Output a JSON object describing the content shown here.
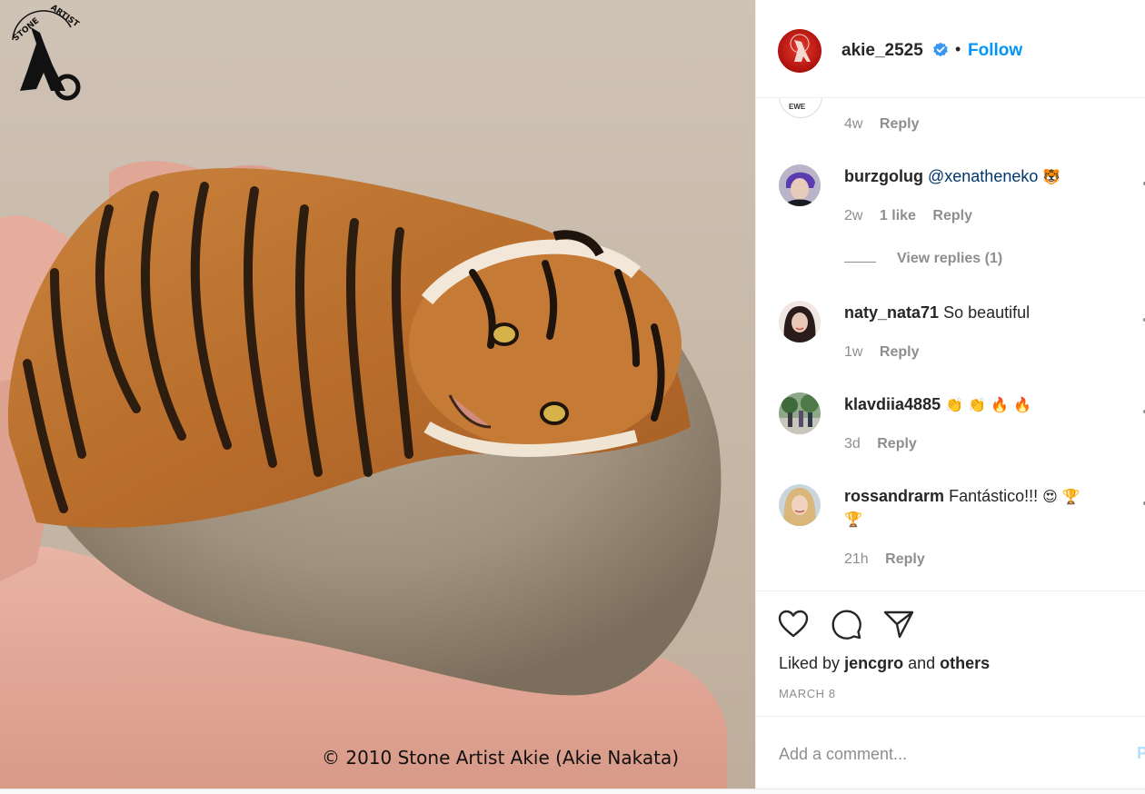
{
  "photo": {
    "credit": "© 2010 Stone Artist Akie (Akie Nakata)",
    "logo_text": "STONE ARTIST"
  },
  "header": {
    "username": "akie_2525",
    "separator": "•",
    "follow_label": "Follow",
    "verified_icon": "verified-badge-icon"
  },
  "comments": {
    "peek": {
      "avatar_text": "EWE",
      "time": "4w",
      "reply_label": "Reply"
    },
    "items": [
      {
        "username": "burzgolug",
        "mention": "@xenatheneko",
        "text": "",
        "emoji": "🐯",
        "time": "2w",
        "likes": "1 like",
        "reply_label": "Reply",
        "view_replies": "View replies (1)"
      },
      {
        "username": "naty_nata71",
        "text": "So beautiful",
        "time": "1w",
        "reply_label": "Reply"
      },
      {
        "username": "klavdiia4885",
        "text": "",
        "emoji": "👏 👏 🔥 🔥",
        "time": "3d",
        "reply_label": "Reply"
      },
      {
        "username": "rossandrarm",
        "text": "Fantástico!!!",
        "emoji": "😍 🏆",
        "emoji_line2": "🏆",
        "time": "21h",
        "reply_label": "Reply"
      }
    ]
  },
  "actions": {
    "icons": [
      "heart-icon",
      "comment-icon",
      "share-icon"
    ],
    "liked_prefix": "Liked by",
    "liked_user": "jencgro",
    "liked_and": "and",
    "liked_others": "others",
    "date": "MARCH 8"
  },
  "add_comment": {
    "placeholder": "Add a comment...",
    "post_label": "Post"
  },
  "colors": {
    "accent": "#0095f6",
    "muted": "#8e8e8e",
    "text": "#262626",
    "border": "#efefef"
  }
}
